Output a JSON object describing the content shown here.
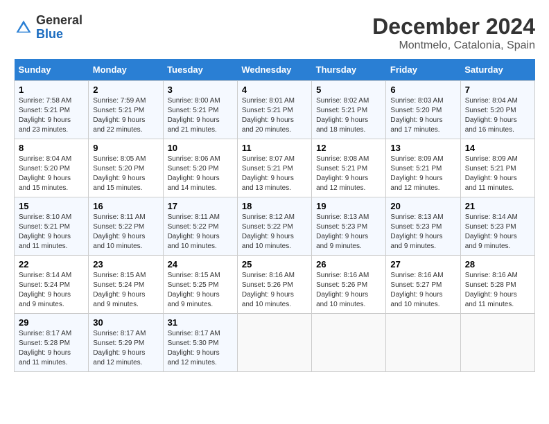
{
  "header": {
    "logo_line1": "General",
    "logo_line2": "Blue",
    "title": "December 2024",
    "subtitle": "Montmelo, Catalonia, Spain"
  },
  "weekdays": [
    "Sunday",
    "Monday",
    "Tuesday",
    "Wednesday",
    "Thursday",
    "Friday",
    "Saturday"
  ],
  "weeks": [
    [
      {
        "day": "1",
        "sunrise": "7:58 AM",
        "sunset": "5:21 PM",
        "daylight": "9 hours and 23 minutes."
      },
      {
        "day": "2",
        "sunrise": "7:59 AM",
        "sunset": "5:21 PM",
        "daylight": "9 hours and 22 minutes."
      },
      {
        "day": "3",
        "sunrise": "8:00 AM",
        "sunset": "5:21 PM",
        "daylight": "9 hours and 21 minutes."
      },
      {
        "day": "4",
        "sunrise": "8:01 AM",
        "sunset": "5:21 PM",
        "daylight": "9 hours and 20 minutes."
      },
      {
        "day": "5",
        "sunrise": "8:02 AM",
        "sunset": "5:21 PM",
        "daylight": "9 hours and 18 minutes."
      },
      {
        "day": "6",
        "sunrise": "8:03 AM",
        "sunset": "5:20 PM",
        "daylight": "9 hours and 17 minutes."
      },
      {
        "day": "7",
        "sunrise": "8:04 AM",
        "sunset": "5:20 PM",
        "daylight": "9 hours and 16 minutes."
      }
    ],
    [
      {
        "day": "8",
        "sunrise": "8:04 AM",
        "sunset": "5:20 PM",
        "daylight": "9 hours and 15 minutes."
      },
      {
        "day": "9",
        "sunrise": "8:05 AM",
        "sunset": "5:20 PM",
        "daylight": "9 hours and 15 minutes."
      },
      {
        "day": "10",
        "sunrise": "8:06 AM",
        "sunset": "5:20 PM",
        "daylight": "9 hours and 14 minutes."
      },
      {
        "day": "11",
        "sunrise": "8:07 AM",
        "sunset": "5:21 PM",
        "daylight": "9 hours and 13 minutes."
      },
      {
        "day": "12",
        "sunrise": "8:08 AM",
        "sunset": "5:21 PM",
        "daylight": "9 hours and 12 minutes."
      },
      {
        "day": "13",
        "sunrise": "8:09 AM",
        "sunset": "5:21 PM",
        "daylight": "9 hours and 12 minutes."
      },
      {
        "day": "14",
        "sunrise": "8:09 AM",
        "sunset": "5:21 PM",
        "daylight": "9 hours and 11 minutes."
      }
    ],
    [
      {
        "day": "15",
        "sunrise": "8:10 AM",
        "sunset": "5:21 PM",
        "daylight": "9 hours and 11 minutes."
      },
      {
        "day": "16",
        "sunrise": "8:11 AM",
        "sunset": "5:22 PM",
        "daylight": "9 hours and 10 minutes."
      },
      {
        "day": "17",
        "sunrise": "8:11 AM",
        "sunset": "5:22 PM",
        "daylight": "9 hours and 10 minutes."
      },
      {
        "day": "18",
        "sunrise": "8:12 AM",
        "sunset": "5:22 PM",
        "daylight": "9 hours and 10 minutes."
      },
      {
        "day": "19",
        "sunrise": "8:13 AM",
        "sunset": "5:23 PM",
        "daylight": "9 hours and 9 minutes."
      },
      {
        "day": "20",
        "sunrise": "8:13 AM",
        "sunset": "5:23 PM",
        "daylight": "9 hours and 9 minutes."
      },
      {
        "day": "21",
        "sunrise": "8:14 AM",
        "sunset": "5:23 PM",
        "daylight": "9 hours and 9 minutes."
      }
    ],
    [
      {
        "day": "22",
        "sunrise": "8:14 AM",
        "sunset": "5:24 PM",
        "daylight": "9 hours and 9 minutes."
      },
      {
        "day": "23",
        "sunrise": "8:15 AM",
        "sunset": "5:24 PM",
        "daylight": "9 hours and 9 minutes."
      },
      {
        "day": "24",
        "sunrise": "8:15 AM",
        "sunset": "5:25 PM",
        "daylight": "9 hours and 9 minutes."
      },
      {
        "day": "25",
        "sunrise": "8:16 AM",
        "sunset": "5:26 PM",
        "daylight": "9 hours and 10 minutes."
      },
      {
        "day": "26",
        "sunrise": "8:16 AM",
        "sunset": "5:26 PM",
        "daylight": "9 hours and 10 minutes."
      },
      {
        "day": "27",
        "sunrise": "8:16 AM",
        "sunset": "5:27 PM",
        "daylight": "9 hours and 10 minutes."
      },
      {
        "day": "28",
        "sunrise": "8:16 AM",
        "sunset": "5:28 PM",
        "daylight": "9 hours and 11 minutes."
      }
    ],
    [
      {
        "day": "29",
        "sunrise": "8:17 AM",
        "sunset": "5:28 PM",
        "daylight": "9 hours and 11 minutes."
      },
      {
        "day": "30",
        "sunrise": "8:17 AM",
        "sunset": "5:29 PM",
        "daylight": "9 hours and 12 minutes."
      },
      {
        "day": "31",
        "sunrise": "8:17 AM",
        "sunset": "5:30 PM",
        "daylight": "9 hours and 12 minutes."
      },
      null,
      null,
      null,
      null
    ]
  ]
}
